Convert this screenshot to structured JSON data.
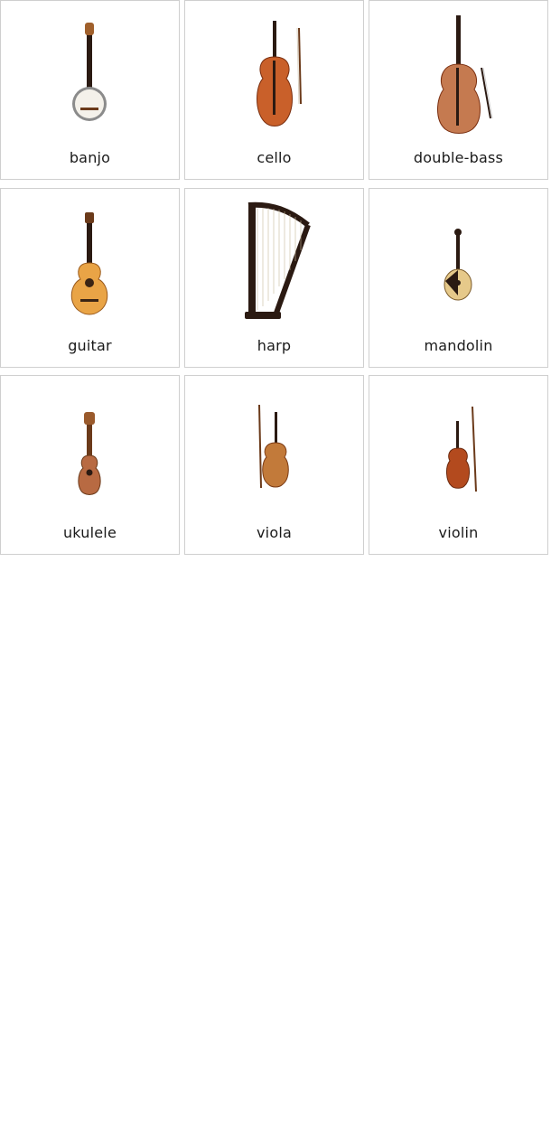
{
  "cards": [
    {
      "label": "banjo",
      "icon": "banjo-icon"
    },
    {
      "label": "cello",
      "icon": "cello-icon"
    },
    {
      "label": "double-bass",
      "icon": "double-bass-icon"
    },
    {
      "label": "guitar",
      "icon": "guitar-icon"
    },
    {
      "label": "harp",
      "icon": "harp-icon"
    },
    {
      "label": "mandolin",
      "icon": "mandolin-icon"
    },
    {
      "label": "ukulele",
      "icon": "ukulele-icon"
    },
    {
      "label": "viola",
      "icon": "viola-icon"
    },
    {
      "label": "violin",
      "icon": "violin-icon"
    }
  ],
  "colors": {
    "card_border": "#cfcfcf",
    "wood": "#c9602a",
    "wood_dark": "#7a2f10",
    "neck": "#2b1a12",
    "guitar_top": "#e9a446"
  }
}
